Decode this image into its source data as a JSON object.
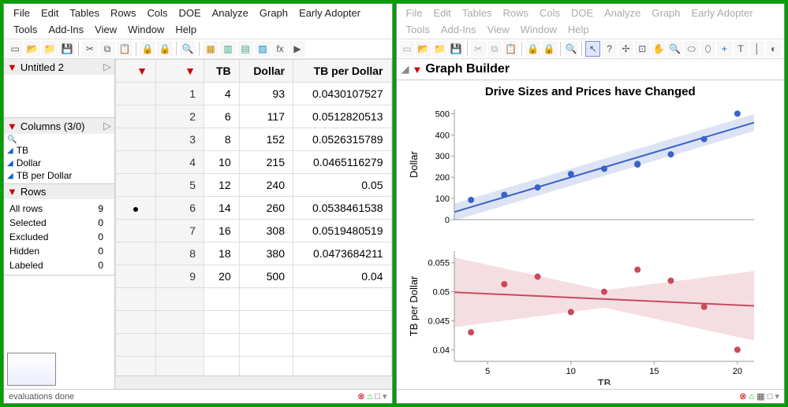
{
  "menu": [
    "File",
    "Edit",
    "Tables",
    "Rows",
    "Cols",
    "DOE",
    "Analyze",
    "Graph",
    "Early Adopter",
    "Tools",
    "Add-Ins",
    "View",
    "Window",
    "Help"
  ],
  "left": {
    "title": "Untitled 2",
    "columns_header": "Columns (3/0)",
    "columns": [
      "TB",
      "Dollar",
      "TB per Dollar"
    ],
    "rows_header": "Rows",
    "rows": [
      {
        "label": "All rows",
        "value": 9
      },
      {
        "label": "Selected",
        "value": 0
      },
      {
        "label": "Excluded",
        "value": 0
      },
      {
        "label": "Hidden",
        "value": 0
      },
      {
        "label": "Labeled",
        "value": 0
      }
    ],
    "status": "evaluations done"
  },
  "table": {
    "headers": [
      "",
      "TB",
      "Dollar",
      "TB per Dollar"
    ],
    "rows": [
      {
        "n": 1,
        "tb": 4,
        "dollar": 93,
        "tpd": "0.0430107527"
      },
      {
        "n": 2,
        "tb": 6,
        "dollar": 117,
        "tpd": "0.0512820513"
      },
      {
        "n": 3,
        "tb": 8,
        "dollar": 152,
        "tpd": "0.0526315789"
      },
      {
        "n": 4,
        "tb": 10,
        "dollar": 215,
        "tpd": "0.0465116279"
      },
      {
        "n": 5,
        "tb": 12,
        "dollar": 240,
        "tpd": "0.05"
      },
      {
        "n": 6,
        "tb": 14,
        "dollar": 260,
        "tpd": "0.0538461538",
        "marked": true
      },
      {
        "n": 7,
        "tb": 16,
        "dollar": 308,
        "tpd": "0.0519480519"
      },
      {
        "n": 8,
        "tb": 18,
        "dollar": 380,
        "tpd": "0.0473684211"
      },
      {
        "n": 9,
        "tb": 20,
        "dollar": 500,
        "tpd": "0.04"
      }
    ]
  },
  "right": {
    "builder_title": "Graph Builder"
  },
  "chart_data": [
    {
      "type": "scatter",
      "title": "Drive Sizes and Prices have Changed",
      "xlabel": "TB",
      "ylabel": "Dollar",
      "x": [
        4,
        6,
        8,
        10,
        12,
        14,
        14,
        16,
        18,
        20
      ],
      "y": [
        93,
        117,
        152,
        215,
        240,
        263,
        260,
        308,
        380,
        500
      ],
      "xlim": [
        3,
        21
      ],
      "ylim": [
        0,
        520
      ],
      "xticks": [
        5,
        10,
        15,
        20
      ],
      "yticks": [
        0,
        100,
        200,
        300,
        400,
        500
      ],
      "fit": {
        "slope": 23.45,
        "intercept": -34.5
      },
      "color": "#3a63c8"
    },
    {
      "type": "scatter",
      "xlabel": "TB",
      "ylabel": "TB per Dollar",
      "x": [
        4,
        6,
        8,
        10,
        12,
        14,
        16,
        18,
        20
      ],
      "y": [
        0.043,
        0.0513,
        0.0526,
        0.0465,
        0.05,
        0.0538,
        0.0519,
        0.0474,
        0.04
      ],
      "xlim": [
        3,
        21
      ],
      "ylim": [
        0.038,
        0.057
      ],
      "xticks": [
        5,
        10,
        15,
        20
      ],
      "yticks": [
        0.04,
        0.045,
        0.05,
        0.055
      ],
      "fit": {
        "slope": -0.00013,
        "intercept": 0.0503
      },
      "color": "#c94a5a"
    }
  ]
}
